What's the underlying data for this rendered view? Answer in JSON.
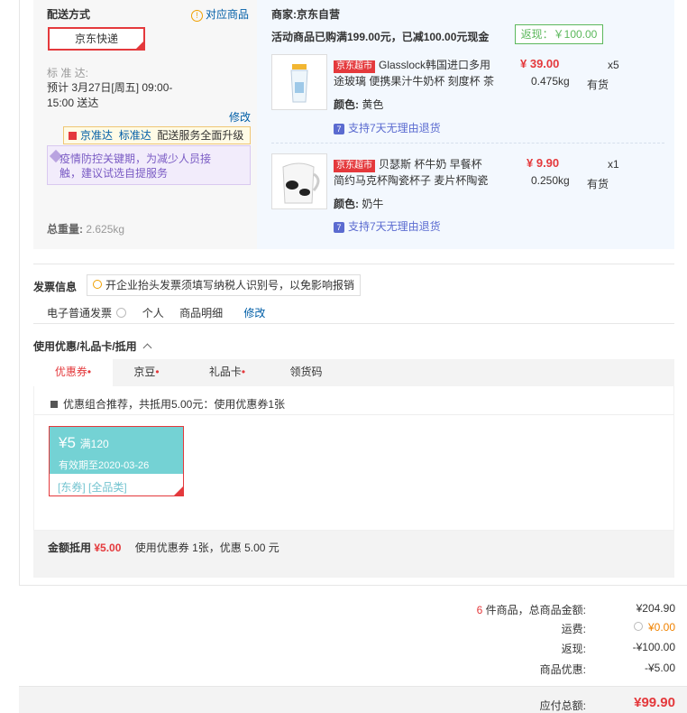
{
  "shipping": {
    "title": "配送方式",
    "match_link": "对应商品",
    "method": "京东快递",
    "eta_label": "标 准 达:",
    "eta_value": "预计 3月27日[周五] 09:00-15:00 送达",
    "eta_line1": "预计 3月27日[周五] 09:00-",
    "eta_line2": "15:00 送达",
    "modify": "修改",
    "promo_items": [
      "京准达",
      "标准达",
      "配送服务全面升级"
    ],
    "epidemic_note_line1": "疫情防控关键期，为减少人员接",
    "epidemic_note_line2": "触，建议试选自提服务",
    "total_weight_label": "总重量:",
    "total_weight_value": "2.625kg"
  },
  "shop": {
    "merchant_label": "商家:",
    "merchant_name": "京东自营",
    "promo_text": "活动商品已购满199.00元，已减100.00元现金",
    "rebate_badge": "返现：￥100.00",
    "products": [
      {
        "tag": "京东超市",
        "title_line1": "Glasslock韩国进口多用",
        "title_line2": "途玻璃 便携果汁牛奶杯 刻度杯 茶",
        "price": "¥ 39.00",
        "qty": "x5",
        "weight": "0.475kg",
        "stock": "有货",
        "color_label": "颜色:",
        "color_value": "黄色",
        "return_policy": "支持7天无理由退货"
      },
      {
        "tag": "京东超市",
        "title_line1": "贝瑟斯 杯牛奶 早餐杯",
        "title_line2": "简约马克杯陶瓷杯子 麦片杯陶瓷",
        "price": "¥ 9.90",
        "qty": "x1",
        "weight": "0.250kg",
        "stock": "有货",
        "color_label": "颜色:",
        "color_value": "奶牛",
        "return_policy": "支持7天无理由退货"
      }
    ]
  },
  "invoice": {
    "title": "发票信息",
    "tip": "开企业抬头发票须填写纳税人识别号，以免影响报销",
    "type": "电子普通发票",
    "holder": "个人",
    "content": "商品明细",
    "modify": "修改"
  },
  "discount": {
    "title": "使用优惠/礼品卡/抵用",
    "tabs": [
      "优惠券",
      "京豆",
      "礼品卡",
      "领货码"
    ],
    "recommend_text": "优惠组合推荐，共抵用5.00元：使用优惠券1张",
    "coupon": {
      "amount": "¥5",
      "condition": "满120",
      "expiry": "有效期至2020-03-26",
      "tags": "[东券]  [全品类]"
    },
    "summary_label": "金额抵用",
    "summary_amount": "¥5.00",
    "summary_desc": "使用优惠券 1张，优惠 5.00 元"
  },
  "totals": {
    "count": "6",
    "count_suffix": "件商品，总商品金额:",
    "goods_amount": "¥204.90",
    "shipping_label": "运费:",
    "shipping_value": "¥0.00",
    "rebate_label": "返现:",
    "rebate_value": "-¥100.00",
    "promo_label": "商品优惠:",
    "promo_value": "-¥5.00",
    "payable_label": "应付总额:",
    "payable_value": "¥99.90"
  },
  "colors": {
    "accent": "#e4393c",
    "link": "#005ea7",
    "coupon": "#74d2d4",
    "rebate": "#5cb85c"
  }
}
